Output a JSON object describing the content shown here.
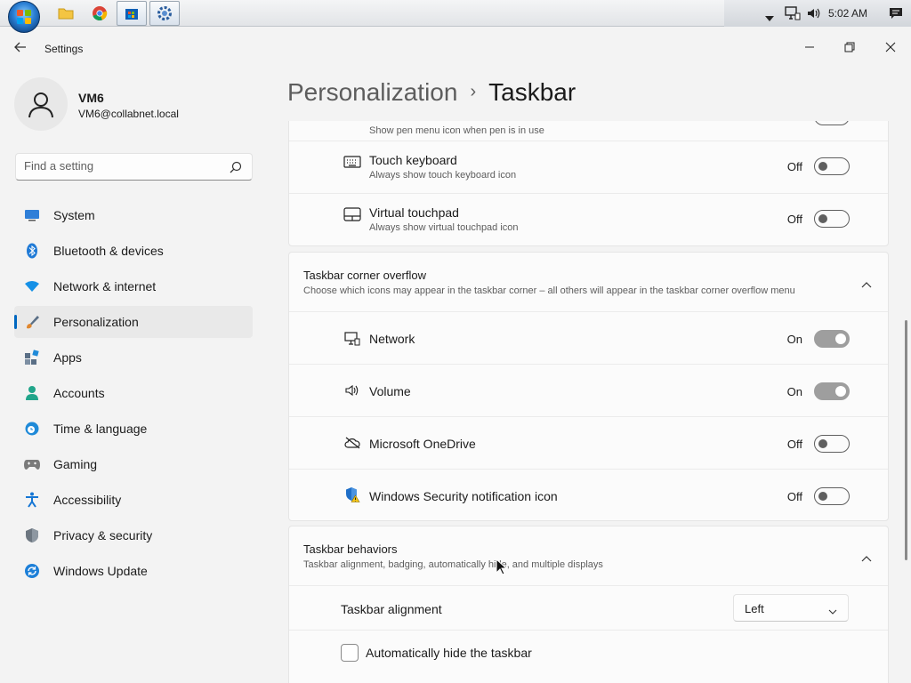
{
  "os_taskbar": {
    "apps": [
      "file-explorer-icon",
      "chrome-icon",
      "store-icon",
      "settings-icon"
    ],
    "clock": "5:02 AM"
  },
  "window": {
    "title": "Settings"
  },
  "user": {
    "name": "VM6",
    "email": "VM6@collabnet.local"
  },
  "search": {
    "placeholder": "Find a setting"
  },
  "sidebar": {
    "items": [
      {
        "label": "System",
        "icon": "system-icon",
        "color": "#2f7fd8"
      },
      {
        "label": "Bluetooth & devices",
        "icon": "bluetooth-icon",
        "color": "#1f7ad6"
      },
      {
        "label": "Network & internet",
        "icon": "wifi-icon",
        "color": "#1590e6"
      },
      {
        "label": "Personalization",
        "icon": "brush-icon",
        "color": "#e0872f",
        "selected": true
      },
      {
        "label": "Apps",
        "icon": "apps-icon",
        "color": "#5a6f86"
      },
      {
        "label": "Accounts",
        "icon": "accounts-icon",
        "color": "#21a58a"
      },
      {
        "label": "Time & language",
        "icon": "globe-clock-icon",
        "color": "#1f8ad8"
      },
      {
        "label": "Gaming",
        "icon": "controller-icon",
        "color": "#7a7a7a"
      },
      {
        "label": "Accessibility",
        "icon": "accessibility-icon",
        "color": "#1576d4"
      },
      {
        "label": "Privacy & security",
        "icon": "shield-icon",
        "color": "#6c7680"
      },
      {
        "label": "Windows Update",
        "icon": "update-icon",
        "color": "#1c7fd8"
      }
    ]
  },
  "header": {
    "parent": "Personalization",
    "separator": "›",
    "current": "Taskbar"
  },
  "taskbar_icons": {
    "pen_menu_sub": "Show pen menu icon when pen is in use",
    "touch_keyboard": {
      "title": "Touch keyboard",
      "sub": "Always show touch keyboard icon",
      "state": "Off"
    },
    "virtual_touchpad": {
      "title": "Virtual touchpad",
      "sub": "Always show virtual touchpad icon",
      "state": "Off"
    }
  },
  "corner_overflow": {
    "title": "Taskbar corner overflow",
    "subtitle": "Choose which icons may appear in the taskbar corner – all others will appear in the taskbar corner overflow menu",
    "items": [
      {
        "title": "Network",
        "state": "On",
        "icon": "network-monitor-icon"
      },
      {
        "title": "Volume",
        "state": "On",
        "icon": "speaker-icon"
      },
      {
        "title": "Microsoft OneDrive",
        "state": "Off",
        "icon": "onedrive-icon"
      },
      {
        "title": "Windows Security notification icon",
        "state": "Off",
        "icon": "security-shield-icon"
      }
    ]
  },
  "behaviors": {
    "title": "Taskbar behaviors",
    "subtitle": "Taskbar alignment, badging, automatically hide, and multiple displays",
    "alignment_label": "Taskbar alignment",
    "alignment_value": "Left",
    "autohide_label": "Automatically hide the taskbar"
  }
}
